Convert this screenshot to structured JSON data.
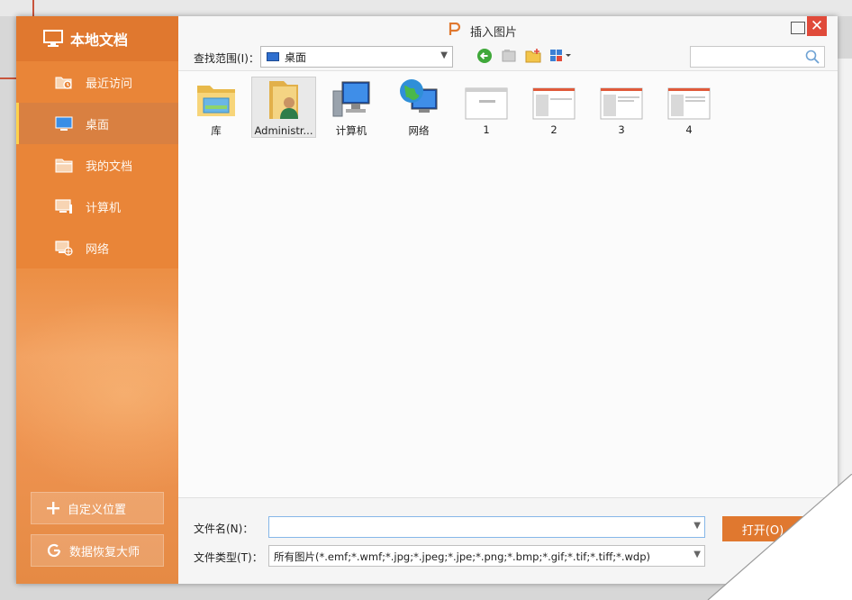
{
  "sidebar": {
    "title": "本地文档",
    "items": [
      {
        "label": "最近访问",
        "icon": "recent-folder-icon"
      },
      {
        "label": "桌面",
        "icon": "desktop-icon",
        "active": true
      },
      {
        "label": "我的文档",
        "icon": "folder-icon"
      },
      {
        "label": "计算机",
        "icon": "computer-icon"
      },
      {
        "label": "网络",
        "icon": "network-icon"
      }
    ],
    "custom_location_label": "自定义位置",
    "data_recovery_label": "数据恢复大师"
  },
  "dialog": {
    "title": "插入图片",
    "close_symbol": "✕"
  },
  "toolbar": {
    "lookin_label": "查找范围(I)：",
    "lookin_value": "桌面",
    "search_placeholder": ""
  },
  "files": [
    {
      "label": "库",
      "icon": "library-folder-icon"
    },
    {
      "label": "Administr...",
      "icon": "user-folder-icon",
      "selected": true
    },
    {
      "label": "计算机",
      "icon": "computer-icon"
    },
    {
      "label": "网络",
      "icon": "network-globe-icon"
    },
    {
      "label": "1",
      "icon": "slide-thumbnail-icon"
    },
    {
      "label": "2",
      "icon": "slide-thumbnail-icon"
    },
    {
      "label": "3",
      "icon": "slide-thumbnail-icon"
    },
    {
      "label": "4",
      "icon": "slide-thumbnail-icon"
    }
  ],
  "form": {
    "filename_label": "文件名(N)：",
    "filename_value": "",
    "filetype_label": "文件类型(T)：",
    "filetype_value": "所有图片(*.emf;*.wmf;*.jpg;*.jpeg;*.jpe;*.png;*.bmp;*.gif;*.tif;*.tiff;*.wdp)",
    "open_label": "打开(O)"
  },
  "colors": {
    "accent": "#e0782f",
    "close": "#e04a3a",
    "active_indicator": "#ffd24a"
  }
}
